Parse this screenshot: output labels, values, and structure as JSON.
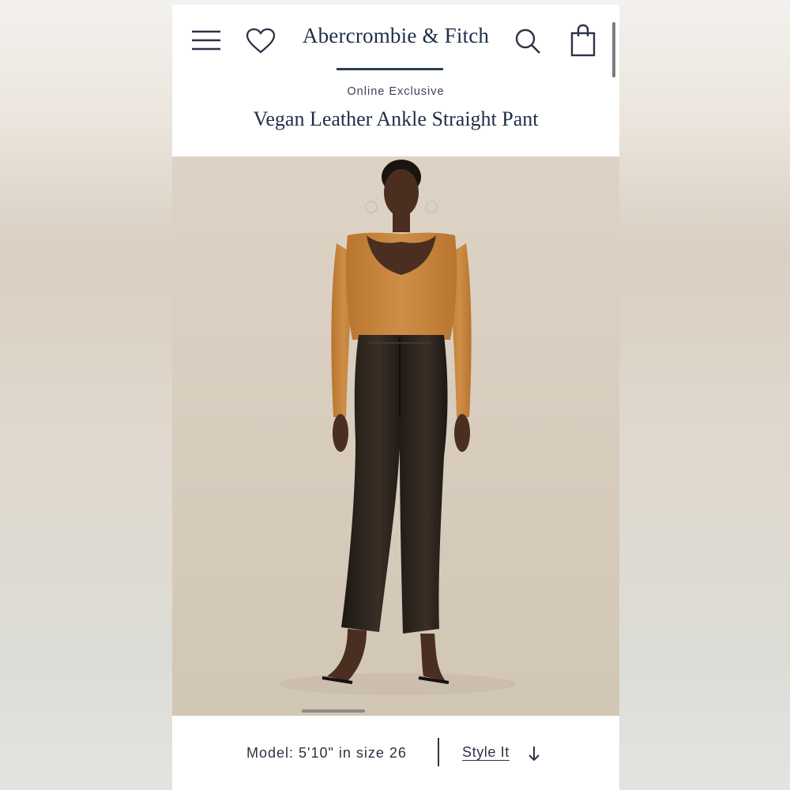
{
  "header": {
    "logo_text": "Abercrombie & Fitch",
    "icons": [
      "menu-icon",
      "heart-icon",
      "search-icon",
      "shopping-bag-icon"
    ]
  },
  "product": {
    "badge": "Online Exclusive",
    "title": "Vegan Leather Ankle Straight Pant"
  },
  "image": {
    "description_icon": "product-photo",
    "top_color": "#c9853b",
    "pant_color": "#2a211b",
    "background_color": "#d6cabb"
  },
  "footer": {
    "model_info": "Model: 5'10\" in size 26",
    "style_link": "Style It",
    "arrow_icon": "arrow-down-icon"
  },
  "colors": {
    "brand_navy": "#1f2f48",
    "text": "#2b3445"
  }
}
